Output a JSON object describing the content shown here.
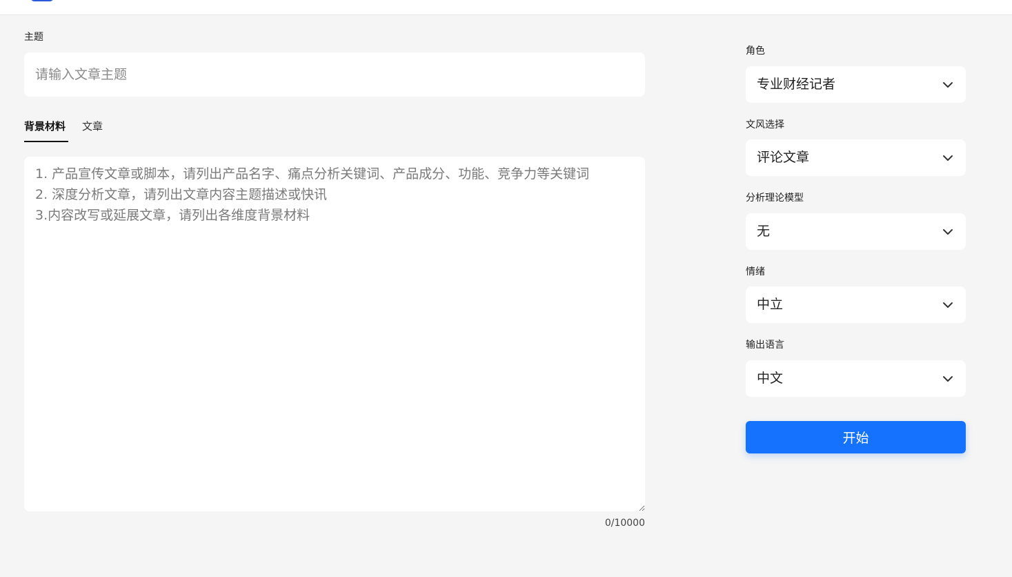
{
  "form": {
    "topic_label": "主题",
    "topic_placeholder": "请输入文章主题",
    "tabs": [
      {
        "label": "背景材料",
        "active": true
      },
      {
        "label": "文章",
        "active": false
      }
    ],
    "material_placeholder": "1. 产品宣传文章或脚本，请列出产品名字、痛点分析关键词、产品成分、功能、竞争力等关键词\n2. 深度分析文章，请列出文章内容主题描述或快讯\n3.内容改写或延展文章，请列出各维度背景材料",
    "counter": "0/10000"
  },
  "settings": {
    "role": {
      "label": "角色",
      "value": "专业财经记者"
    },
    "style": {
      "label": "文风选择",
      "value": "评论文章"
    },
    "model": {
      "label": "分析理论模型",
      "value": "无"
    },
    "emotion": {
      "label": "情绪",
      "value": "中立"
    },
    "language": {
      "label": "输出语言",
      "value": "中文"
    },
    "start_label": "开始"
  },
  "colors": {
    "accent": "#1472ff",
    "background": "#f5f5f5"
  },
  "icons": {
    "dropdown": "chevron-down-icon"
  }
}
